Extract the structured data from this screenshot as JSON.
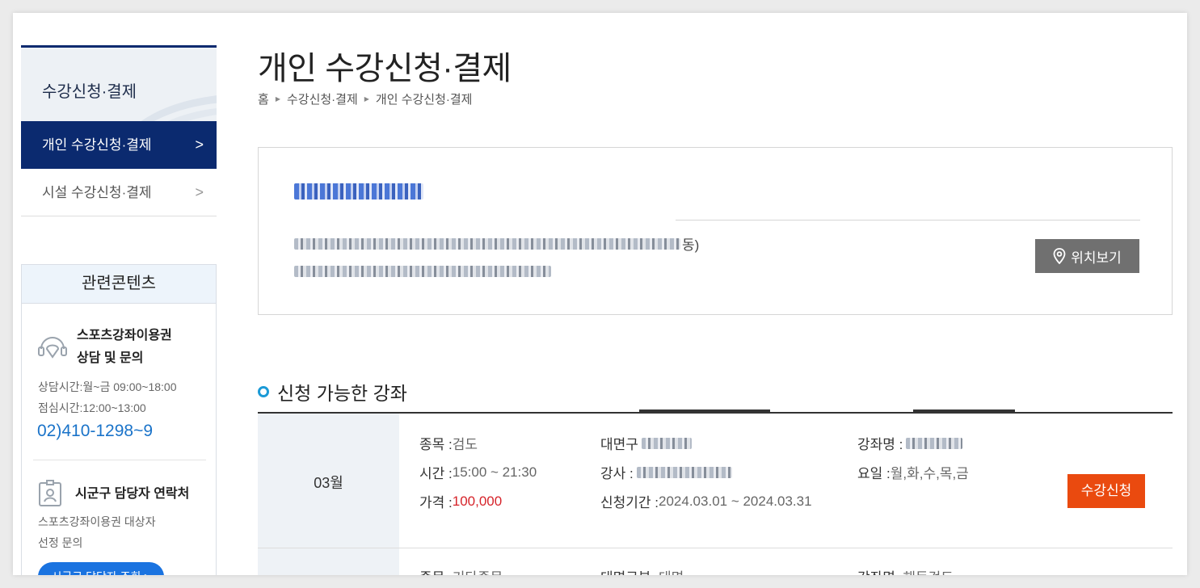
{
  "sidebar": {
    "title": "수강신청·결제",
    "items": [
      {
        "label": "개인 수강신청·결제",
        "chevron": ">"
      },
      {
        "label": "시설 수강신청·결제",
        "chevron": ">"
      }
    ]
  },
  "related": {
    "heading": "관련콘텐츠",
    "consult": {
      "title_line1": "스포츠강좌이용권",
      "title_line2": "상담 및 문의",
      "hours": "상담시간:월~금 09:00~18:00",
      "lunch": "점심시간:12:00~13:00",
      "phone": "02)410-1298~9"
    },
    "contact": {
      "title": "시군구 담당자 연락처",
      "desc_line1": "스포츠강좌이용권 대상자",
      "desc_line2": "선정 문의",
      "button": "시군구 담당자 조회 >"
    }
  },
  "page": {
    "title": "개인 수강신청·결제",
    "breadcrumb": [
      "홈",
      "수강신청·결제",
      "개인 수강신청·결제"
    ]
  },
  "facility": {
    "address_tail": "동)",
    "location_button": "위치보기"
  },
  "section": {
    "title": "신청 가능한 강좌"
  },
  "courses": [
    {
      "month": "03월",
      "sport_label": "종목 : ",
      "sport": "검도",
      "time_label": "시간 : ",
      "time": "15:00 ~ 21:30",
      "price_label": "가격 : ",
      "price": "100,000",
      "type_label": "대면구",
      "teacher_label": "강사 : ",
      "period_label": "신청기간 : ",
      "period": "2024.03.01 ~ 2024.03.31",
      "course_label": "강좌명 : ",
      "days_label": "요일 : ",
      "days": "월,화,수,목,금",
      "apply_button": "수강신청"
    },
    {
      "sport_label": "종목 : ",
      "sport": "기타종목",
      "type_label": "대면구분 : ",
      "type": "대면",
      "course_label": "강좌명 : ",
      "course": "해동검도"
    }
  ],
  "colors": {
    "navy": "#0b2a6f",
    "accent_blue": "#1a73c9",
    "apply_orange": "#ea4a0f",
    "price_red": "#d6232a"
  }
}
